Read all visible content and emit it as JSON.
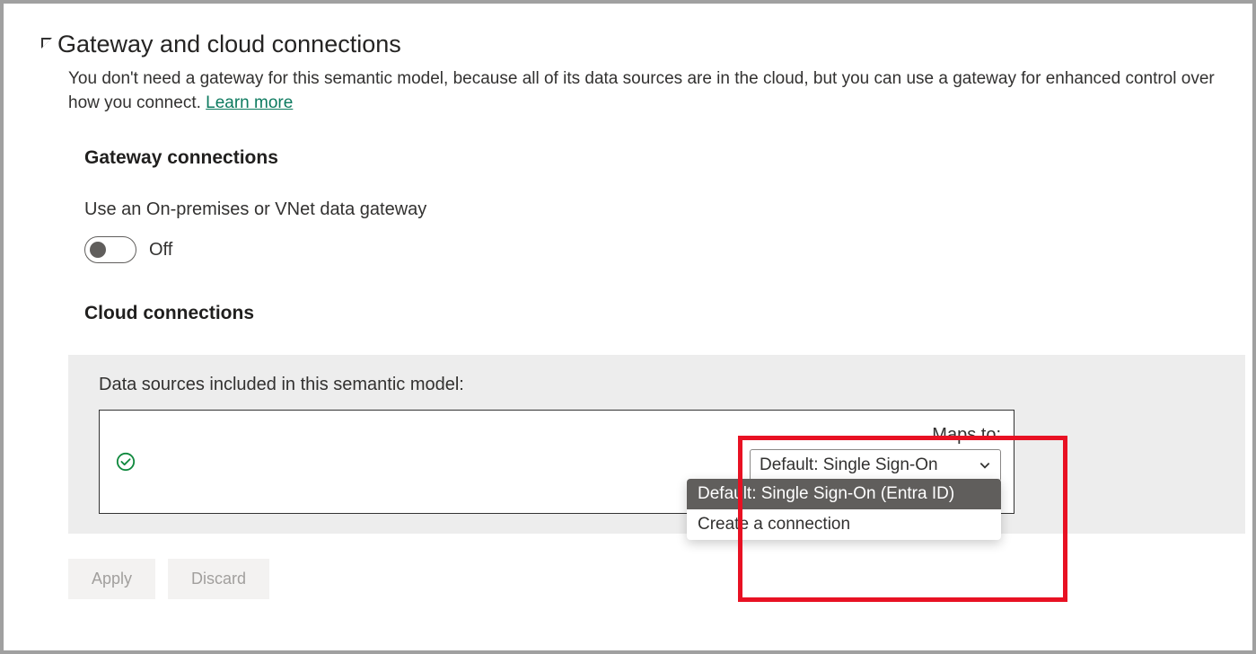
{
  "section": {
    "title": "Gateway and cloud connections",
    "desc_prefix": "You don't need a gateway for this semantic model, because all of its data sources are in the cloud, but you can use a gateway for enhanced control over how you connect. ",
    "learn_more": "Learn more"
  },
  "gateway": {
    "title": "Gateway connections",
    "toggle_label": "Use an On-premises or VNet data gateway",
    "toggle_state": "Off"
  },
  "cloud": {
    "title": "Cloud connections",
    "panel_label": "Data sources included in this semantic model:",
    "maps_to": "Maps to:",
    "dropdown_value": "Default: Single Sign-On",
    "options": [
      "Default: Single Sign-On (Entra ID)",
      "Create a connection"
    ]
  },
  "buttons": {
    "apply": "Apply",
    "discard": "Discard"
  }
}
